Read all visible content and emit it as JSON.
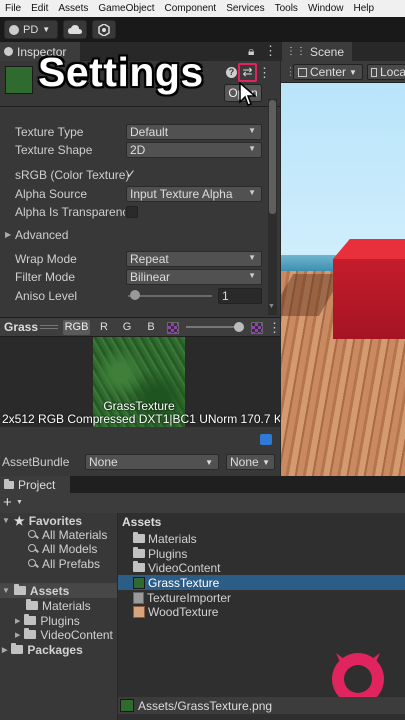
{
  "menu": [
    "File",
    "Edit",
    "Assets",
    "GameObject",
    "Component",
    "Services",
    "Tools",
    "Window",
    "Help"
  ],
  "toolbar": {
    "account_label": "PD"
  },
  "inspector": {
    "tab_label": "Inspector",
    "overlay_title": "Settings",
    "open_label": "Open",
    "fields": [
      {
        "label": "Texture Type",
        "value": "Default"
      },
      {
        "label": "Texture Shape",
        "value": "2D"
      },
      {
        "label": "sRGB (Color Texture)",
        "checked": true
      },
      {
        "label": "Alpha Source",
        "value": "Input Texture Alpha"
      },
      {
        "label": "Alpha Is Transparenc",
        "checked": false
      },
      {
        "label": "Advanced"
      },
      {
        "label": "Wrap Mode",
        "value": "Repeat"
      },
      {
        "label": "Filter Mode",
        "value": "Bilinear"
      },
      {
        "label": "Aniso Level",
        "value": "1"
      }
    ],
    "preview": {
      "title": "Grass",
      "channels": [
        "RGB",
        "R",
        "G",
        "B"
      ],
      "texture_name": "GrassTexture",
      "info": "2x512  RGB Compressed DXT1|BC1 UNorm  170.7 K"
    },
    "asset_bundle": {
      "label": "AssetBundle",
      "value": "None",
      "variant": "None"
    }
  },
  "scene": {
    "tab_label": "Scene",
    "pivot_label": "Center",
    "space_label": "Loca"
  },
  "project": {
    "tab_label": "Project",
    "favorites": {
      "label": "Favorites",
      "items": [
        "All Materials",
        "All Models",
        "All Prefabs"
      ]
    },
    "assets_root": {
      "label": "Assets",
      "children": [
        "Materials",
        "Plugins",
        "VideoContent"
      ]
    },
    "packages_label": "Packages",
    "breadcrumb": "Assets",
    "files": [
      {
        "name": "Materials",
        "kind": "folder"
      },
      {
        "name": "Plugins",
        "kind": "folder"
      },
      {
        "name": "VideoContent",
        "kind": "folder"
      },
      {
        "name": "GrassTexture",
        "kind": "texture",
        "selected": true
      },
      {
        "name": "TextureImporter",
        "kind": "script"
      },
      {
        "name": "WoodTexture",
        "kind": "wood"
      }
    ],
    "status_path": "Assets/GrassTexture.png"
  },
  "colors": {
    "selection": "#2c5d87",
    "accent_red": "#e0245e",
    "grass": "#2f6b2f"
  }
}
